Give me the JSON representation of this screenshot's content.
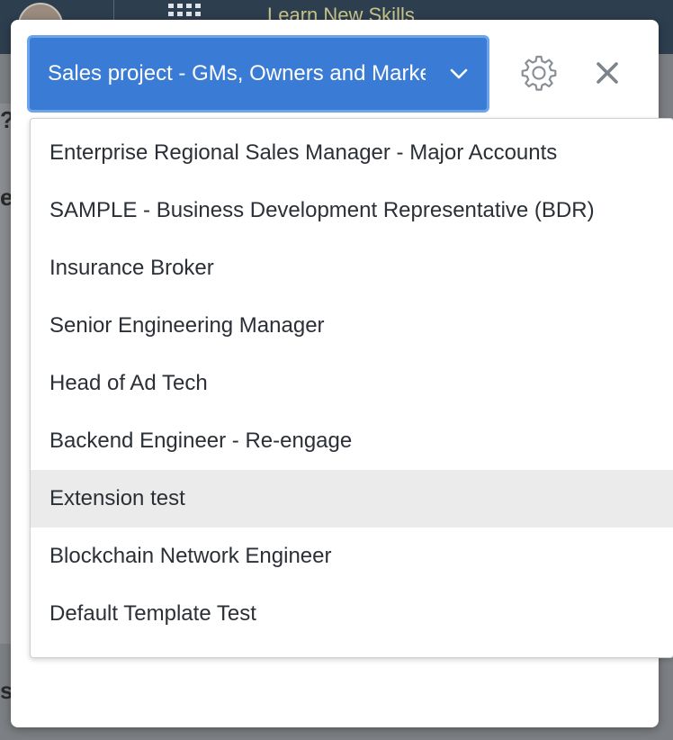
{
  "background": {
    "header_title": "Learn New Skills",
    "fragments": [
      "?",
      "e",
      "sc"
    ]
  },
  "selector": {
    "selected_label": "Sales project - GMs, Owners and Marketing",
    "accent": "#3a7bd5"
  },
  "icons": {
    "settings": "gear-icon",
    "close": "close-icon",
    "chevron": "chevron-down-icon"
  },
  "dropdown": {
    "options": [
      {
        "label": "Enterprise Regional Sales Manager - Major Accounts"
      },
      {
        "label": "SAMPLE - Business Development Representative (BDR)"
      },
      {
        "label": "Insurance Broker"
      },
      {
        "label": "Senior Engineering Manager"
      },
      {
        "label": "Head of Ad Tech"
      },
      {
        "label": "Backend Engineer - Re-engage"
      },
      {
        "label": "Extension test"
      },
      {
        "label": "Blockchain Network Engineer"
      },
      {
        "label": "Default Template Test"
      }
    ],
    "highlighted_label": "Extension test"
  }
}
